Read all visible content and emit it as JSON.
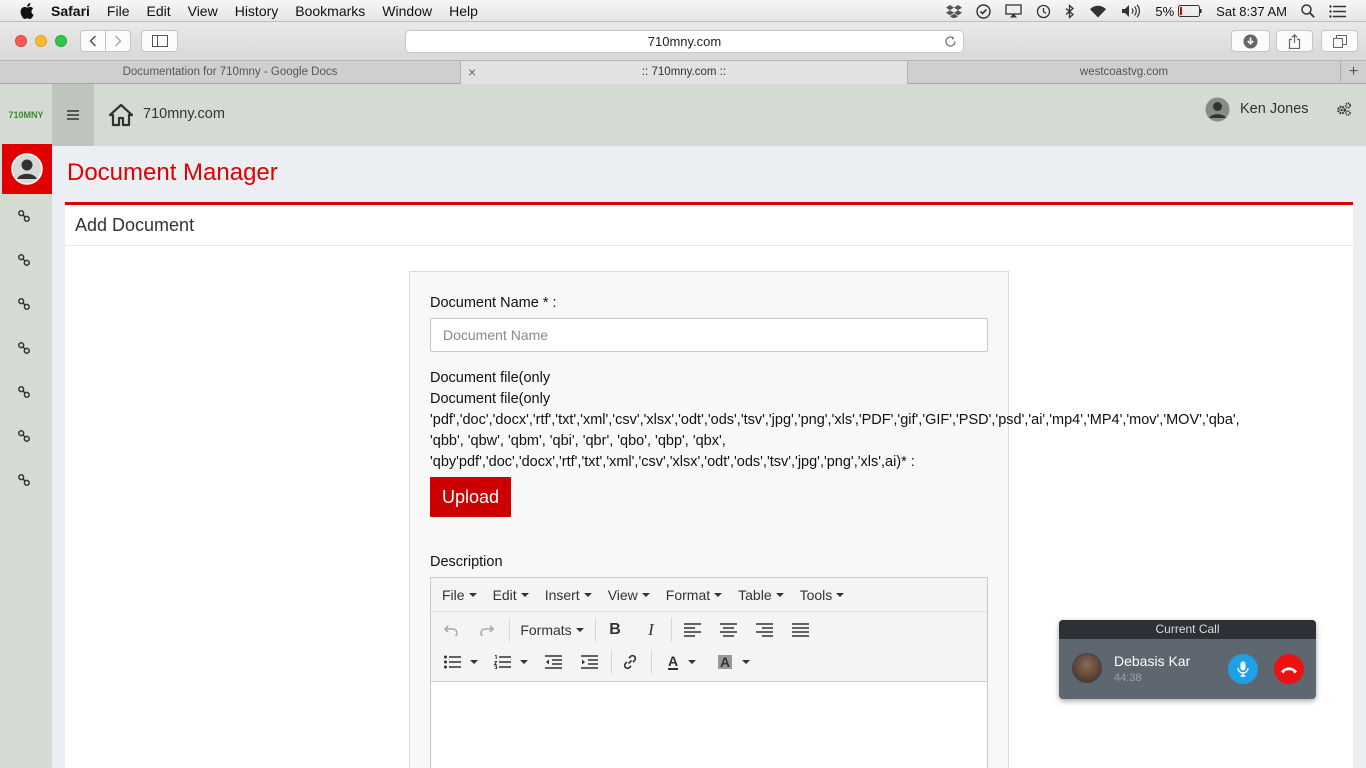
{
  "menubar": {
    "app": "Safari",
    "items": [
      "File",
      "Edit",
      "View",
      "History",
      "Bookmarks",
      "Window",
      "Help"
    ],
    "battery": "5%",
    "clock": "Sat 8:37 AM"
  },
  "browser": {
    "url": "710mny.com",
    "tabs": [
      {
        "title": "Documentation for 710mny - Google Docs",
        "active": false
      },
      {
        "title": ":: 710mny.com ::",
        "active": true
      },
      {
        "title": "westcoastvg.com",
        "active": false
      }
    ]
  },
  "header": {
    "logo_text": "710MNY",
    "site_name": "710mny.com",
    "user_name": "Ken Jones"
  },
  "page": {
    "title": "Document Manager",
    "panel_title": "Add Document"
  },
  "form": {
    "doc_name_label": "Document Name * :",
    "doc_name_placeholder": "Document Name",
    "file_label_lines": [
      "Document file(only",
      "Document file(only",
      "'pdf','doc','docx','rtf','txt','xml','csv','xlsx','odt','ods','tsv','jpg','png','xls','PDF','gif','GIF','PSD','psd','ai','mp4','MP4','mov','MOV','qba',",
      "'qbb', 'qbw', 'qbm', 'qbi', 'qbr', 'qbo', 'qbp', 'qbx',",
      "'qby'pdf','doc','docx','rtf','txt','xml','csv','xlsx','odt','ods','tsv','jpg','png','xls',ai)* :"
    ],
    "upload_label": "Upload",
    "description_label": "Description"
  },
  "editor": {
    "menu": [
      "File",
      "Edit",
      "Insert",
      "View",
      "Format",
      "Table",
      "Tools"
    ],
    "formats_label": "Formats",
    "bold_label": "B",
    "italic_label": "I",
    "text_color_label": "A",
    "bg_color_label": "A"
  },
  "call": {
    "header": "Current Call",
    "name": "Debasis Kar",
    "duration": "44:38"
  },
  "colors": {
    "accent_red": "#e00000",
    "sidebar_bg": "#d4dbd3",
    "call_mic": "#1ea0e6",
    "call_hangup": "#ee1111"
  }
}
